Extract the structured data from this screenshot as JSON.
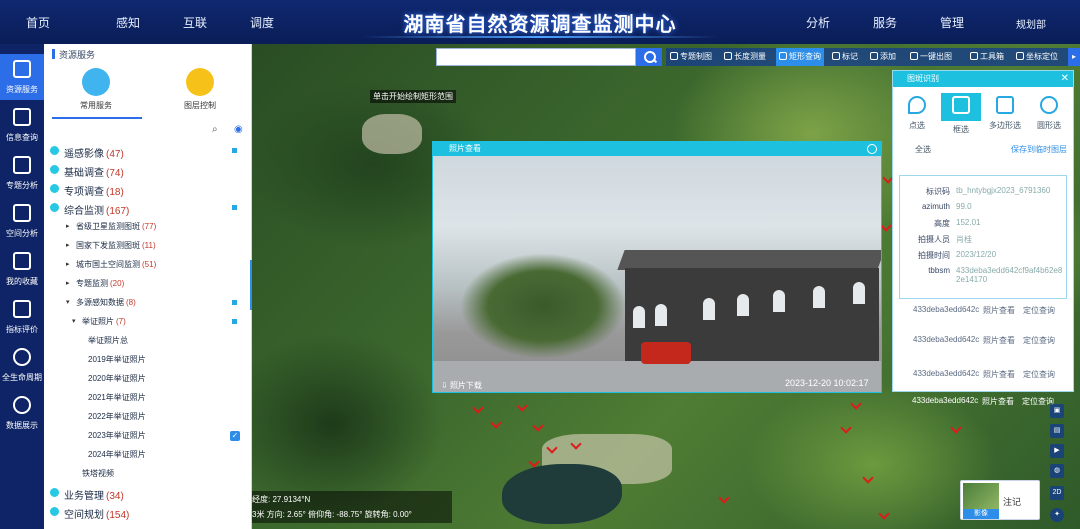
{
  "header": {
    "title": "湖南省自然资源调查监测中心",
    "nav_left": [
      "首页",
      "感知",
      "互联",
      "调度"
    ],
    "nav_right": [
      "分析",
      "服务",
      "管理"
    ],
    "user": "规划部"
  },
  "rail": [
    {
      "label": "资源服务",
      "active": true
    },
    {
      "label": "信息查询"
    },
    {
      "label": "专题分析"
    },
    {
      "label": "空间分析"
    },
    {
      "label": "我的收藏"
    },
    {
      "label": "指标评价"
    },
    {
      "label": "全生命周期"
    },
    {
      "label": "数据展示"
    }
  ],
  "panel": {
    "title": "资源服务",
    "services": [
      {
        "label": "常用服务",
        "color": "#3fb4ee"
      },
      {
        "label": "图层控制",
        "color": "#f6c21a"
      }
    ],
    "tree": [
      {
        "level": 0,
        "name": "遥感影像",
        "count": "(47)",
        "square": true
      },
      {
        "level": 0,
        "name": "基础调查",
        "count": "(74)"
      },
      {
        "level": 0,
        "name": "专项调查",
        "count": "(18)"
      },
      {
        "level": 0,
        "name": "综合监测",
        "count": "(167)",
        "square": true
      },
      {
        "level": 1,
        "name": "省级卫星监测图斑",
        "count": "(77)",
        "twisty": "▸"
      },
      {
        "level": 1,
        "name": "国家下发监测图斑",
        "count": "(11)",
        "twisty": "▸"
      },
      {
        "level": 1,
        "name": "城市国土空间监测",
        "count": "(51)",
        "twisty": "▸"
      },
      {
        "level": 1,
        "name": "专题监测",
        "count": "(20)",
        "twisty": "▸"
      },
      {
        "level": 1,
        "name": "多源感知数据",
        "count": "(8)",
        "twisty": "▾",
        "square": true
      },
      {
        "level": 2,
        "name": "举证照片",
        "count": "(7)",
        "twisty": "▾",
        "square": true
      },
      {
        "level": 3,
        "name": "举证照片总",
        "count": ""
      },
      {
        "level": 3,
        "name": "2019年举证照片",
        "count": ""
      },
      {
        "level": 3,
        "name": "2020年举证照片",
        "count": ""
      },
      {
        "level": 3,
        "name": "2021年举证照片",
        "count": ""
      },
      {
        "level": 3,
        "name": "2022年举证照片",
        "count": ""
      },
      {
        "level": 3,
        "name": "2023年举证照片",
        "count": "",
        "checked": true
      },
      {
        "level": 3,
        "name": "2024年举证照片",
        "count": ""
      },
      {
        "level": 2,
        "name": "铁塔视频",
        "count": ""
      },
      {
        "level": 0,
        "name": "业务管理",
        "count": "(34)"
      },
      {
        "level": 0,
        "name": "空间规划",
        "count": "(154)"
      }
    ]
  },
  "map": {
    "hint": "单击开始绘制矩形范围",
    "search": {
      "placeholder": "",
      "value": ""
    },
    "toolbar": [
      "专题制图",
      "长度测量",
      "矩形查询",
      "标记",
      "添加",
      "一键出图",
      "工具箱",
      "坐标定位"
    ],
    "toolbar_active": "矩形查询",
    "status_line1": "经度: 27.9134°N",
    "status_line2": "3米  方向: 2.65°  俯仰角: -88.75°  旋转角: 0.00°",
    "basemap_tag": "影像",
    "basemap_label": "注记",
    "side_tools": [
      "2D"
    ]
  },
  "photo_viewer": {
    "title": "照片查看",
    "download": "照片下载",
    "timestamp": "2023-12-20 10:02:17"
  },
  "query": {
    "title": "图斑识别",
    "tools": [
      {
        "label": "点选"
      },
      {
        "label": "框选",
        "active": true
      },
      {
        "label": "多边形选"
      },
      {
        "label": "圆形选"
      }
    ],
    "all_label": "全选",
    "save_label": "保存到临时图层",
    "detail": [
      {
        "k": "标识码",
        "v": "tb_hntybgjx2023_6791360"
      },
      {
        "k": "azimuth",
        "v": "99.0"
      },
      {
        "k": "高度",
        "v": "152.01"
      },
      {
        "k": "拍摄人员",
        "v": "肖桂"
      },
      {
        "k": "拍摄时间",
        "v": "2023/12/20"
      },
      {
        "k": "tbbsm",
        "v": "433deba3edd642cf9af4b62e82e14170"
      }
    ],
    "list": [
      {
        "id": "433deba3edd642c",
        "a": "照片查看",
        "b": "定位查询"
      },
      {
        "id": "433deba3edd642c",
        "a": "照片查看",
        "b": "定位查询"
      },
      {
        "id": "433deba3edd642c",
        "a": "照片查看",
        "b": "定位查询"
      },
      {
        "id": "433deba3edd642c",
        "a": "照片查看",
        "b": "定位查询"
      }
    ]
  },
  "colors": {
    "accent": "#2c6ee8",
    "cyan": "#1ec0e0",
    "header": "#0a1d57"
  }
}
